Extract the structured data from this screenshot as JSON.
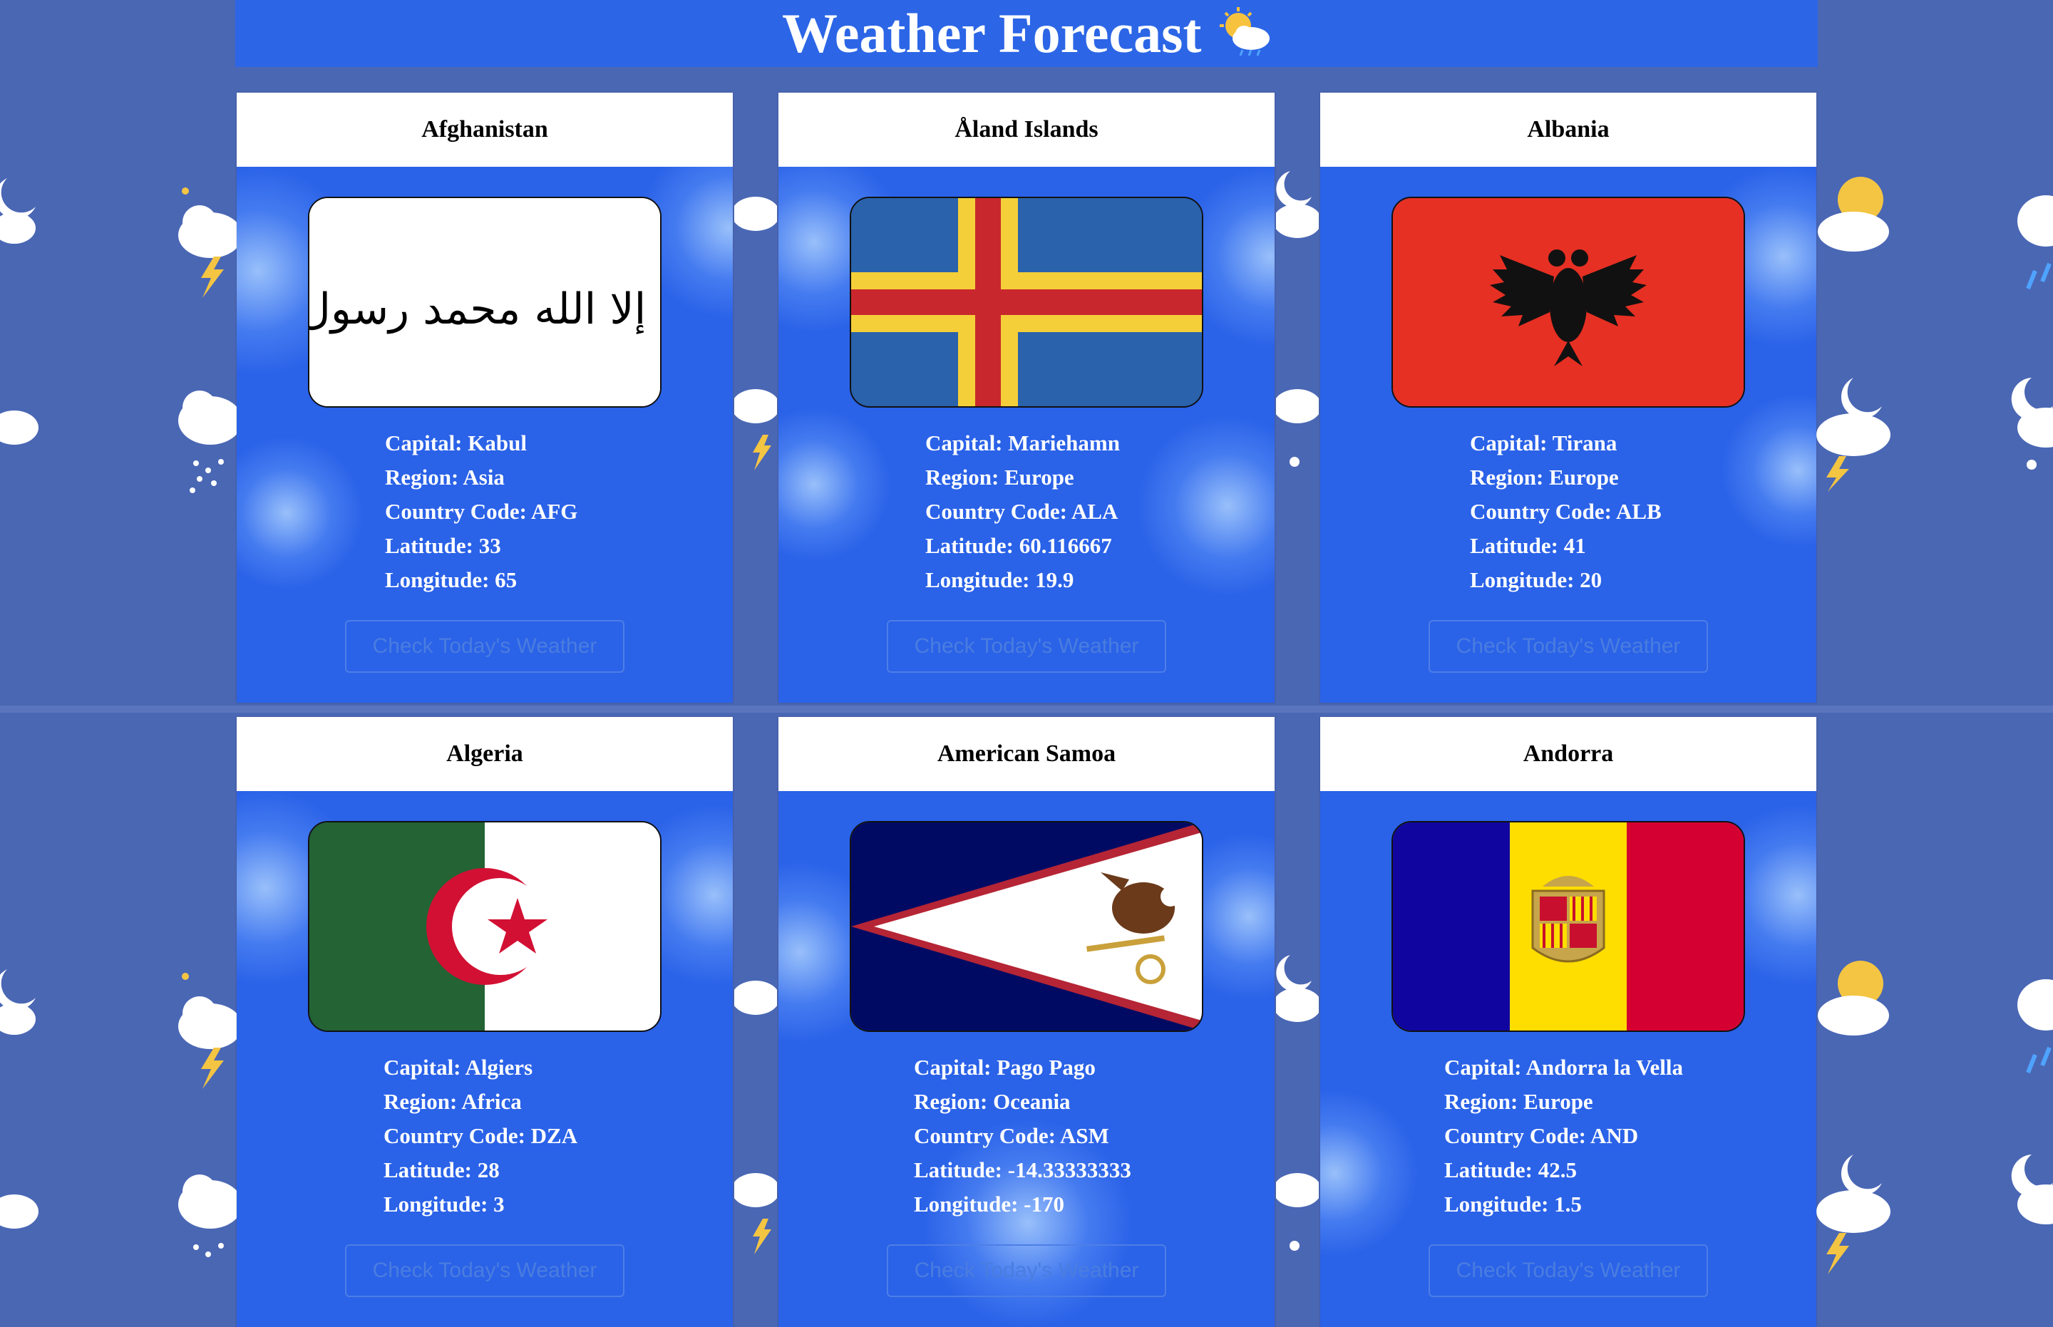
{
  "header": {
    "title": "Weather Forecast",
    "icon": "sun-cloud-rain-icon"
  },
  "colors": {
    "header_bg": "#2c66e6",
    "card_bg": "#2a62e8",
    "page_bg": "#4a67b4"
  },
  "cards": [
    {
      "name": "Afghanistan",
      "flag": "flag-afghanistan",
      "capital": "Capital: Kabul",
      "region": "Region: Asia",
      "code": "Country Code: AFG",
      "lat": "Latitude: 33",
      "lng": "Longitude: 65",
      "button": "Check Today's Weather",
      "flag_text": "لا إله إلا الله محمد رسول الله"
    },
    {
      "name": "Åland Islands",
      "flag": "flag-aland",
      "capital": "Capital: Mariehamn",
      "region": "Region: Europe",
      "code": "Country Code: ALA",
      "lat": "Latitude: 60.116667",
      "lng": "Longitude: 19.9",
      "button": "Check Today's Weather"
    },
    {
      "name": "Albania",
      "flag": "flag-albania",
      "capital": "Capital: Tirana",
      "region": "Region: Europe",
      "code": "Country Code: ALB",
      "lat": "Latitude: 41",
      "lng": "Longitude: 20",
      "button": "Check Today's Weather"
    },
    {
      "name": "Algeria",
      "flag": "flag-algeria",
      "capital": "Capital: Algiers",
      "region": "Region: Africa",
      "code": "Country Code: DZA",
      "lat": "Latitude: 28",
      "lng": "Longitude: 3",
      "button": "Check Today's Weather"
    },
    {
      "name": "American Samoa",
      "flag": "flag-american-samoa",
      "capital": "Capital: Pago Pago",
      "region": "Region: Oceania",
      "code": "Country Code: ASM",
      "lat": "Latitude: -14.33333333",
      "lng": "Longitude: -170",
      "button": "Check Today's Weather"
    },
    {
      "name": "Andorra",
      "flag": "flag-andorra",
      "capital": "Capital: Andorra la Vella",
      "region": "Region: Europe",
      "code": "Country Code: AND",
      "lat": "Latitude: 42.5",
      "lng": "Longitude: 1.5",
      "button": "Check Today's Weather"
    }
  ]
}
